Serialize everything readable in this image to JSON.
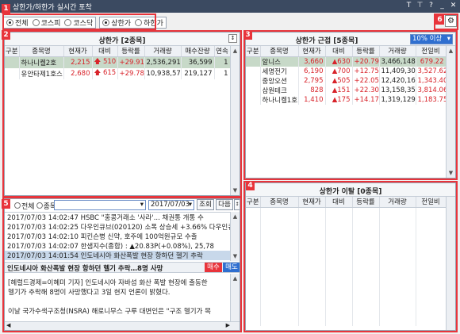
{
  "window": {
    "title": "상한가/하한가 실시간 포착"
  },
  "titlebar_icons": [
    "T",
    "pin",
    "?",
    "minimize",
    "close"
  ],
  "badges": [
    "1",
    "2",
    "3",
    "4",
    "5",
    "6"
  ],
  "filter": {
    "options": [
      {
        "label": "전체",
        "checked": true
      },
      {
        "label": "코스피",
        "checked": false
      },
      {
        "label": "코스닥",
        "checked": false
      }
    ],
    "limit_options": [
      {
        "label": "상한가",
        "checked": true
      },
      {
        "label": "하한가",
        "checked": false
      }
    ]
  },
  "panel_upper": {
    "title": "상한가 [2종목]",
    "columns": [
      "구분",
      "종목명",
      "현재가",
      "대비",
      "등락률",
      "거래량",
      "매수잔량",
      "연속"
    ],
    "rows": [
      {
        "name": "하나니켈2호",
        "price": "2,215",
        "change": "510",
        "rate": "+29.91",
        "volume": "2,536,291",
        "bid": "36,599",
        "streak": "1",
        "selected": true
      },
      {
        "name": "유안타제1호스",
        "price": "2,680",
        "change": "615",
        "rate": "+29.78",
        "volume": "10,938,575",
        "bid": "219,127",
        "streak": "1",
        "selected": false
      }
    ]
  },
  "panel_near": {
    "title": "상한가 근접 [5종목]",
    "dropdown": "10% 이상",
    "columns": [
      "구분",
      "종목명",
      "현재가",
      "대비",
      "등락률",
      "거래량",
      "전일비"
    ],
    "rows": [
      {
        "name": "알니스",
        "price": "3,660",
        "change": "630",
        "rate": "+20.79",
        "volume": "3,466,148",
        "prev": "679.22",
        "selected": true
      },
      {
        "name": "세명전기",
        "price": "6,190",
        "change": "700",
        "rate": "+12.75",
        "volume": "11,409,300",
        "prev": "3,527.62",
        "selected": false
      },
      {
        "name": "중앙오션",
        "price": "2,795",
        "change": "505",
        "rate": "+22.05",
        "volume": "12,420,162",
        "prev": "1,343.40",
        "selected": false
      },
      {
        "name": "삼원테크",
        "price": "828",
        "change": "151",
        "rate": "+22.30",
        "volume": "13,158,356",
        "prev": "3,814.06",
        "selected": false
      },
      {
        "name": "하나니켈1호",
        "price": "1,410",
        "change": "175",
        "rate": "+14.17",
        "volume": "1,319,129",
        "prev": "1,183.75",
        "selected": false
      }
    ]
  },
  "panel_break": {
    "title": "상한가 이탈 [0종목]",
    "columns": [
      "구분",
      "종목명",
      "현재가",
      "대비",
      "등락률",
      "거래량",
      "전일비"
    ]
  },
  "news": {
    "scope_options": [
      {
        "label": "전체",
        "checked": true
      },
      {
        "label": "종목",
        "checked": false
      }
    ],
    "date": "2017/07/03",
    "search_button": "조회",
    "next_button": "다음",
    "items": [
      {
        "text": "2017/07/03  14:02:47 HSBC \"홍콩거래소 '사라'... 채권통 개통 수",
        "selected": false
      },
      {
        "text": "2017/07/03  14:02:25 다우인큐브(020120)  소폭 상승세 +3.66%  다우인큐브",
        "selected": false
      },
      {
        "text": "2017/07/03  14:02:10 피킨슨병 신약, 호주에 100억원규모 수출",
        "selected": false
      },
      {
        "text": "2017/07/03  14:02:07 한샘지수(종합) : ▲20.83P(+0.08%), 25,78",
        "selected": false
      },
      {
        "text": "2017/07/03  14:01:54 인도네시아 화산폭발 현장 항하던 헬기 추락",
        "selected": true
      }
    ],
    "headline": "인도네시아 화산폭발 현장 항하던 헬기 추락…8명 사망",
    "buy_button": "매수",
    "sell_button": "매도",
    "body": [
      "[헤럴드경제=이혜미 기자] 인도네시아 자바섬 화산 폭발 현장에 출동한",
      "헬기가 추락해 8명이 사망했다고 3일 현지 언론이 밝혔다.",
      "",
      "이날 국가수색구조청(NSRA) 해로니무스 구루 대변인은 \"구조 헬기가 목"
    ]
  },
  "colors": {
    "up": "#d8232a",
    "accent": "#e8343b",
    "selected_row": "#c7d9c8",
    "titlebar": "#3b4a61"
  }
}
